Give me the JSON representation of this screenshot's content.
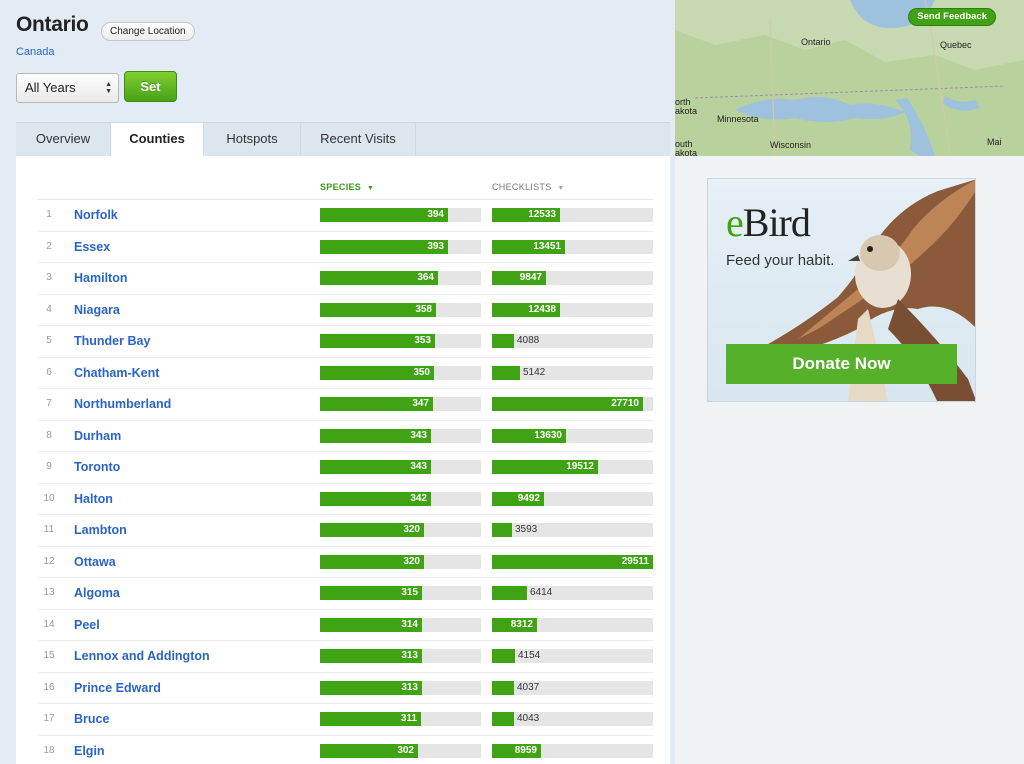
{
  "location": {
    "title": "Ontario",
    "change_label": "Change Location",
    "country": "Canada"
  },
  "filter": {
    "selected": "All Years",
    "set_label": "Set"
  },
  "tabs": [
    {
      "label": "Overview"
    },
    {
      "label": "Counties"
    },
    {
      "label": "Hotspots"
    },
    {
      "label": "Recent Visits"
    }
  ],
  "columns": {
    "species": "SPECIES",
    "checklists": "CHECKLISTS"
  },
  "rows": [
    {
      "rank": "1",
      "name": "Norfolk",
      "species": 394,
      "checklists": 12533
    },
    {
      "rank": "2",
      "name": "Essex",
      "species": 393,
      "checklists": 13451
    },
    {
      "rank": "3",
      "name": "Hamilton",
      "species": 364,
      "checklists": 9847
    },
    {
      "rank": "4",
      "name": "Niagara",
      "species": 358,
      "checklists": 12438
    },
    {
      "rank": "5",
      "name": "Thunder Bay",
      "species": 353,
      "checklists": 4088
    },
    {
      "rank": "6",
      "name": "Chatham-Kent",
      "species": 350,
      "checklists": 5142
    },
    {
      "rank": "7",
      "name": "Northumberland",
      "species": 347,
      "checklists": 27710
    },
    {
      "rank": "8",
      "name": "Durham",
      "species": 343,
      "checklists": 13630
    },
    {
      "rank": "9",
      "name": "Toronto",
      "species": 343,
      "checklists": 19512
    },
    {
      "rank": "10",
      "name": "Halton",
      "species": 342,
      "checklists": 9492
    },
    {
      "rank": "11",
      "name": "Lambton",
      "species": 320,
      "checklists": 3593
    },
    {
      "rank": "12",
      "name": "Ottawa",
      "species": 320,
      "checklists": 29511
    },
    {
      "rank": "13",
      "name": "Algoma",
      "species": 315,
      "checklists": 6414
    },
    {
      "rank": "14",
      "name": "Peel",
      "species": 314,
      "checklists": 8312
    },
    {
      "rank": "15",
      "name": "Lennox and Addington",
      "species": 313,
      "checklists": 4154
    },
    {
      "rank": "16",
      "name": "Prince Edward",
      "species": 313,
      "checklists": 4037
    },
    {
      "rank": "17",
      "name": "Bruce",
      "species": 311,
      "checklists": 4043
    },
    {
      "rank": "18",
      "name": "Elgin",
      "species": 302,
      "checklists": 8959
    }
  ],
  "map": {
    "feedback_label": "Send Feedback",
    "labels": [
      "Ontario",
      "Quebec",
      "orth",
      "akota",
      "Minnesota",
      "outh",
      "akota",
      "Wisconsin",
      "Mai"
    ]
  },
  "ad": {
    "logo_e": "e",
    "logo_rest": "Bird",
    "tagline": "Feed your habit.",
    "button": "Donate Now"
  },
  "colors": {
    "accent_green": "#3fa314",
    "link_blue": "#2b64c9",
    "page_bg": "#e3ecf4"
  }
}
